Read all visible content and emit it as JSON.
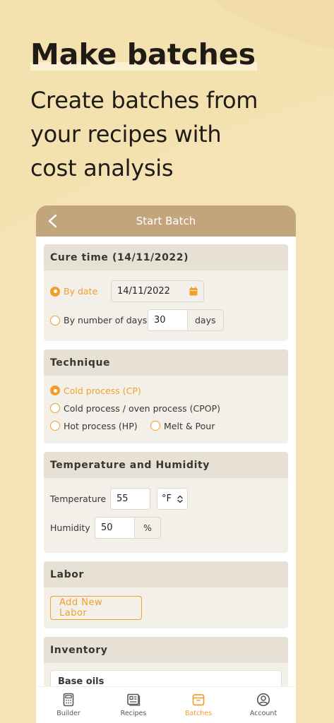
{
  "promo": {
    "title": "Make batches",
    "subtitle_lines": [
      "Create batches from",
      "your recipes with",
      "cost analysis"
    ]
  },
  "nav": {
    "title": "Start Batch",
    "back_icon": "chevron-left-icon"
  },
  "cure": {
    "title": "Cure time (14/11/2022)",
    "by_date_label": "By date",
    "date_value": "14/11/2022",
    "calendar_icon": "calendar-icon",
    "by_days_label": "By number of days",
    "days_value": "30",
    "days_unit": "days",
    "selected": "by_date"
  },
  "technique": {
    "title": "Technique",
    "options": [
      "Cold process (CP)",
      "Cold process / oven process (CPOP)",
      "Hot process (HP)",
      "Melt & Pour"
    ],
    "selected": "Cold process (CP)"
  },
  "environment": {
    "title": "Temperature and Humidity",
    "temperature_label": "Temperature",
    "temperature_value": "55",
    "temperature_unit": "°F",
    "humidity_label": "Humidity",
    "humidity_value": "50",
    "humidity_unit": "%"
  },
  "labor": {
    "title": "Labor",
    "add_button": "Add New Labor"
  },
  "inventory": {
    "title": "Inventory",
    "sub_item": "Base oils"
  },
  "tabs": [
    {
      "label": "Builder",
      "icon": "calculator-icon"
    },
    {
      "label": "Recipes",
      "icon": "recipe-book-icon"
    },
    {
      "label": "Batches",
      "icon": "box-icon"
    },
    {
      "label": "Account",
      "icon": "user-circle-icon"
    }
  ],
  "active_tab": "Batches",
  "colors": {
    "accent": "#f0a02a",
    "nav": "#c2a57d",
    "background": "#f4e1b0"
  }
}
